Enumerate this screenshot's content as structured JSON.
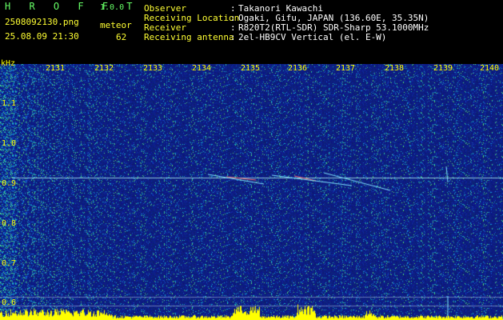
{
  "header": {
    "app_title": "H R O F F T",
    "app_version": "1.0.0",
    "filename": "2508092130.png",
    "datetime": "25.08.09 21:30",
    "meteor_label": "meteor",
    "meteor_count": "62",
    "fields": [
      {
        "label": "Observer",
        "value": "Takanori Kawachi"
      },
      {
        "label": "Receiving Location",
        "value": "Ogaki, Gifu, JAPAN (136.60E, 35.35N)"
      },
      {
        "label": "Receiver",
        "value": "R820T2(RTL-SDR) SDR-Sharp 53.1000MHz"
      },
      {
        "label": "Receiving antenna",
        "value": "2el-HB9CV Vertical (el. E-W)"
      }
    ],
    "separator": ":"
  },
  "spectrogram": {
    "y_unit": "kHz",
    "x_ticks": [
      "2131",
      "2132",
      "2133",
      "2134",
      "2135",
      "2136",
      "2137",
      "2138",
      "2139",
      "2140"
    ],
    "y_ticks": [
      "1.1",
      "1.0",
      "0.9",
      "0.8",
      "0.7",
      "0.6"
    ]
  },
  "colors": {
    "background": "#000000",
    "title_green": "#66ff66",
    "label_yellow": "#ffff33",
    "value_white": "#ffffff",
    "tick_yellow": "#ffff00",
    "spectrum_base": "#0d1a86",
    "signal_line": "#a8ecf0"
  }
}
